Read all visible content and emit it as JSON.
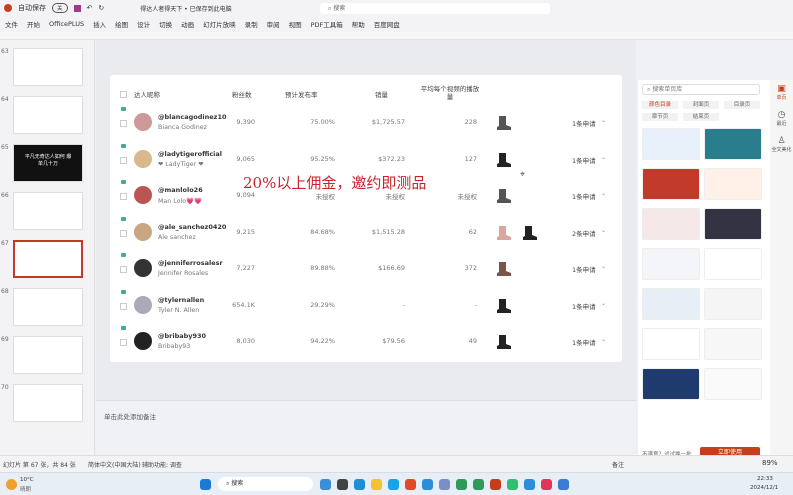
{
  "titlebar": {
    "autosave": "自动保存",
    "toggle": "关",
    "doc_title": "得达人者得天下 • 已保存到此电脑",
    "search": "搜索"
  },
  "menu": [
    "文件",
    "开始",
    "OfficePLUS",
    "插入",
    "绘图",
    "设计",
    "切换",
    "动画",
    "幻灯片放映",
    "录制",
    "审阅",
    "视图",
    "PDF工具箱",
    "帮助",
    "百度网盘"
  ],
  "thumbs": {
    "numbers": [
      "63",
      "64",
      "65",
      "66",
      "67",
      "68",
      "69",
      "70"
    ],
    "selected": "67",
    "thumb65_text": "平凡无奇达人如何 爆单几十万"
  },
  "table": {
    "headers": {
      "name": "达人昵称",
      "fans": "粉丝数",
      "rate": "预计发布率",
      "sales": "销量",
      "avg_views": "平均每个视频的播放量"
    },
    "rows": [
      {
        "handle": "@blancagodinez10",
        "name": "Bianca Godinez",
        "fans": "9,390",
        "rate": "75.00%",
        "sales": "$1,725.57",
        "views": "228",
        "requests": "1条申请",
        "boots": [
          "#555"
        ]
      },
      {
        "handle": "@ladytigerofficial",
        "name": "❤ LadyTiger ❤",
        "fans": "9,065",
        "rate": "95.25%",
        "sales": "$372.23",
        "views": "127",
        "requests": "1条申请",
        "boots": [
          "#222"
        ]
      },
      {
        "handle": "@manlolo26",
        "name": "Man Lolo💗💗",
        "fans": "9,094",
        "rate": "未授权",
        "sales": "未授权",
        "views": "未授权",
        "requests": "1条申请",
        "boots": [
          "#555"
        ]
      },
      {
        "handle": "@ale_sanchez0420",
        "name": "Ale sanchez",
        "fans": "9,215",
        "rate": "84.68%",
        "sales": "$1,515.28",
        "views": "62",
        "requests": "2条申请",
        "boots": [
          "#d9a7a0",
          "#222"
        ]
      },
      {
        "handle": "@jenniferrosalesr",
        "name": "Jennifer Rosales",
        "fans": "7,227",
        "rate": "89.88%",
        "sales": "$166.69",
        "views": "372",
        "requests": "1条申请",
        "boots": [
          "#7a5548"
        ]
      },
      {
        "handle": "@tylernallen",
        "name": "Tyler N. Allen",
        "fans": "654.1K",
        "rate": "29.29%",
        "sales": "-",
        "views": "-",
        "requests": "1条申请",
        "boots": [
          "#222"
        ]
      },
      {
        "handle": "@bribaby930",
        "name": "Bribaby93",
        "fans": "8,030",
        "rate": "94.22%",
        "sales": "$79.56",
        "views": "49",
        "requests": "1条申请",
        "boots": [
          "#222"
        ]
      }
    ]
  },
  "overlay_text": "20%以上佣金，邀约即测品",
  "notes_placeholder": "单击此处添加备注",
  "right_panel": {
    "search": "搜索单页库",
    "chips": [
      "颜色目录",
      "封面页",
      "目录页",
      "章节页",
      "结束页"
    ],
    "side": [
      "单页",
      "最近",
      "全文美化"
    ],
    "apply_button": "立即使用",
    "footer": "不满意？试试换一批"
  },
  "status": {
    "slide": "幻灯片 第 67 张，共 84 张",
    "lang": "简体中文(中国大陆)",
    "access": "辅助功能: 调查",
    "notes": "备注",
    "zoom": "89%"
  },
  "taskbar": {
    "weather": "10°C",
    "weather_sub": "晴朗",
    "search": "搜索",
    "time": "22:33",
    "date": "2024/12/1"
  },
  "colors": {
    "accent": "#c43e1c",
    "overlay": "#c8232c"
  }
}
